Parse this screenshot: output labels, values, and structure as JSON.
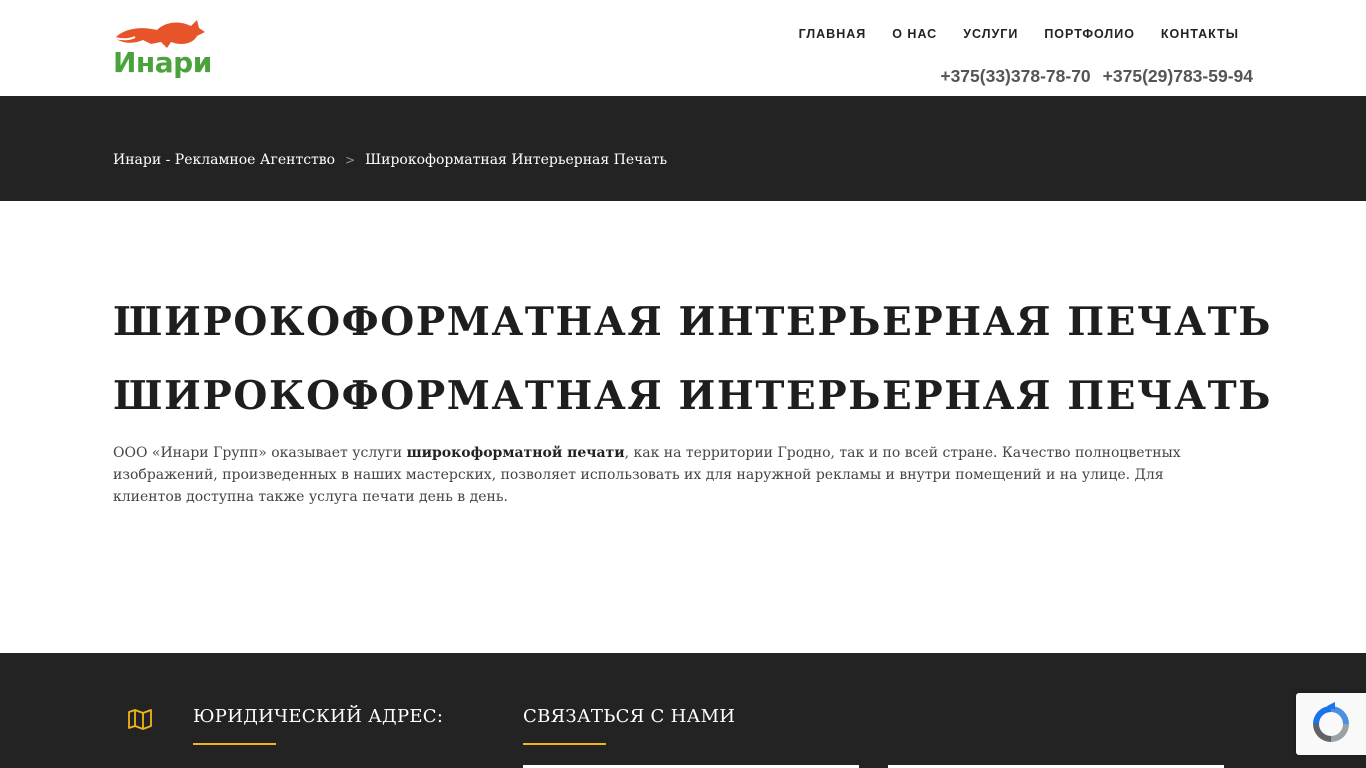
{
  "logo": {
    "text": "Инари",
    "brand_green": "#4aa23c",
    "fox_color": "#e8542a"
  },
  "nav": {
    "items": [
      {
        "label": "ГЛАВНАЯ"
      },
      {
        "label": "О НАС"
      },
      {
        "label": "УСЛУГИ"
      },
      {
        "label": "ПОРТФОЛИО"
      },
      {
        "label": "КОНТАКТЫ"
      }
    ]
  },
  "phones": [
    "+375(33)378-78-70",
    "+375(29)783-59-94"
  ],
  "breadcrumb": {
    "home": "Инари - Рекламное Агентство",
    "separator": ">",
    "current": "Широкоформатная Интерьерная Печать"
  },
  "main": {
    "title": "ШИРОКОФОРМАТНАЯ ИНТЕРЬЕРНАЯ ПЕЧАТЬ",
    "subtitle": "ШИРОКОФОРМАТНАЯ ИНТЕРЬЕРНАЯ ПЕЧАТЬ",
    "paragraph": {
      "before": "ООО «Инари Групп» оказывает услуги ",
      "bold": "широкоформатной печати",
      "after": ", как на территории Гродно, так и по всей стране. Качество полноцветных изображений, произведенных в наших мастерских, позволяет использовать их для наружной рекламы и внутри помещений и на улице. Для клиентов доступна также услуга печати день в день."
    }
  },
  "footer": {
    "address_heading": "ЮРИДИЧЕСКИЙ АДРЕС:",
    "contact_heading": "СВЯЗАТЬСЯ С НАМИ",
    "accent_color": "#f0b51b",
    "background": "#232323"
  },
  "icons": {
    "map": "map-icon",
    "recaptcha": "recaptcha-icon"
  }
}
